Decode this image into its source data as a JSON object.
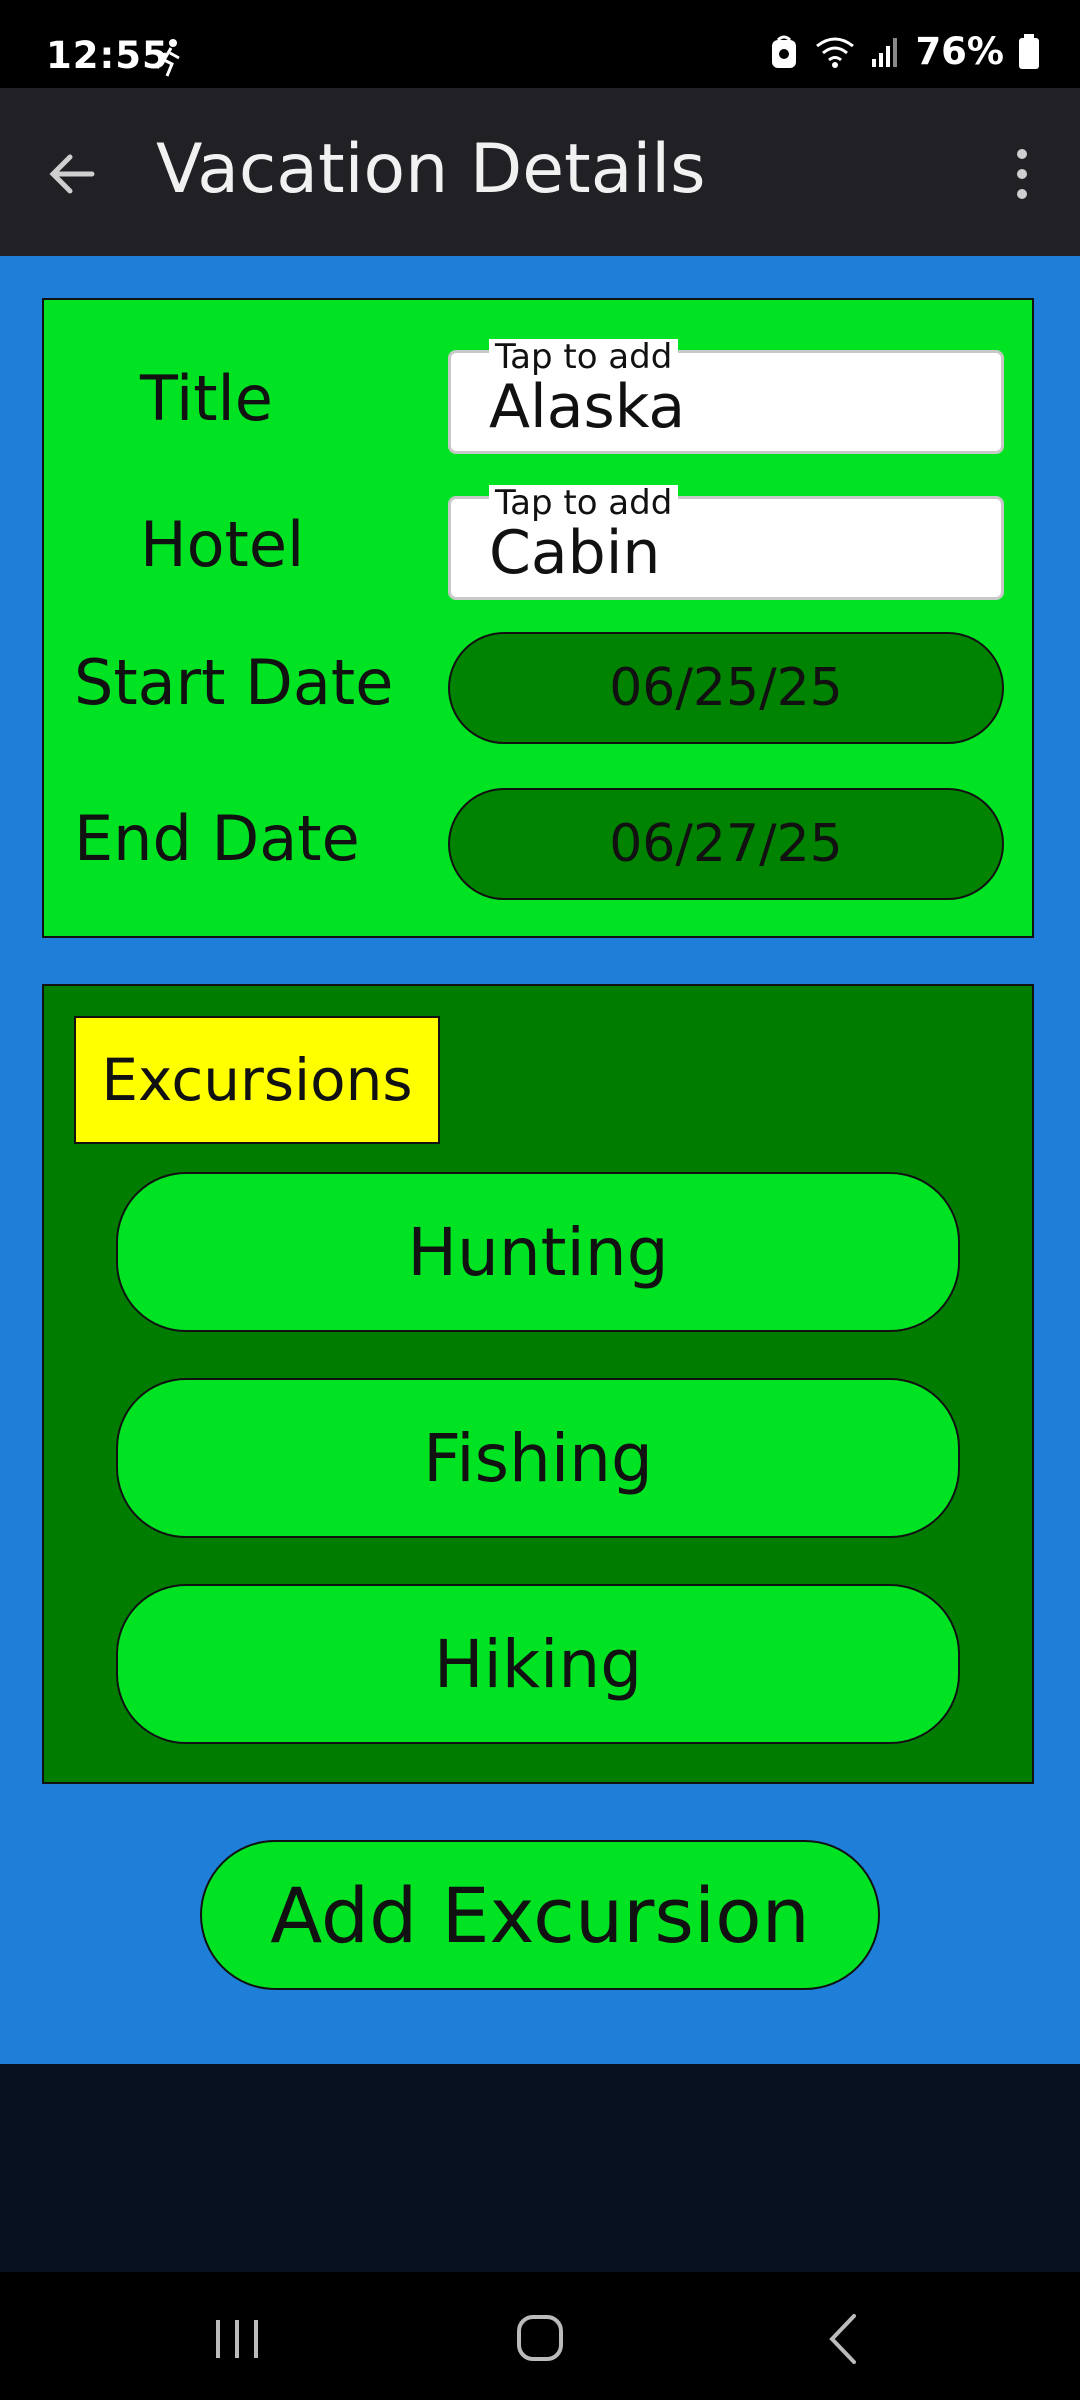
{
  "status_bar": {
    "time": "12:55",
    "battery": "76%",
    "icons": [
      "running-person-icon",
      "lock-icon",
      "wifi-icon",
      "signal-icon",
      "battery-icon"
    ]
  },
  "app_bar": {
    "title": "Vacation Details",
    "back_icon": "arrow-left-icon",
    "menu_icon": "more-vert-icon"
  },
  "vacation": {
    "title_label": "Title",
    "title_placeholder": "Tap to add",
    "title_value": "Alaska",
    "hotel_label": "Hotel",
    "hotel_placeholder": "Tap to add",
    "hotel_value": "Cabin",
    "start_label": "Start Date",
    "start_value": "06/25/25",
    "end_label": "End Date",
    "end_value": "06/27/25"
  },
  "excursions": {
    "header": "Excursions",
    "items": [
      {
        "label": "Hunting"
      },
      {
        "label": "Fishing"
      },
      {
        "label": "Hiking"
      }
    ]
  },
  "actions": {
    "add_excursion": "Add Excursion"
  },
  "colors": {
    "app_background": "#1f7ed8",
    "bright_green": "#00e322",
    "dark_green": "#007d00",
    "date_button_green": "#008300",
    "header_yellow": "#ffff00",
    "appbar": "#202025"
  }
}
